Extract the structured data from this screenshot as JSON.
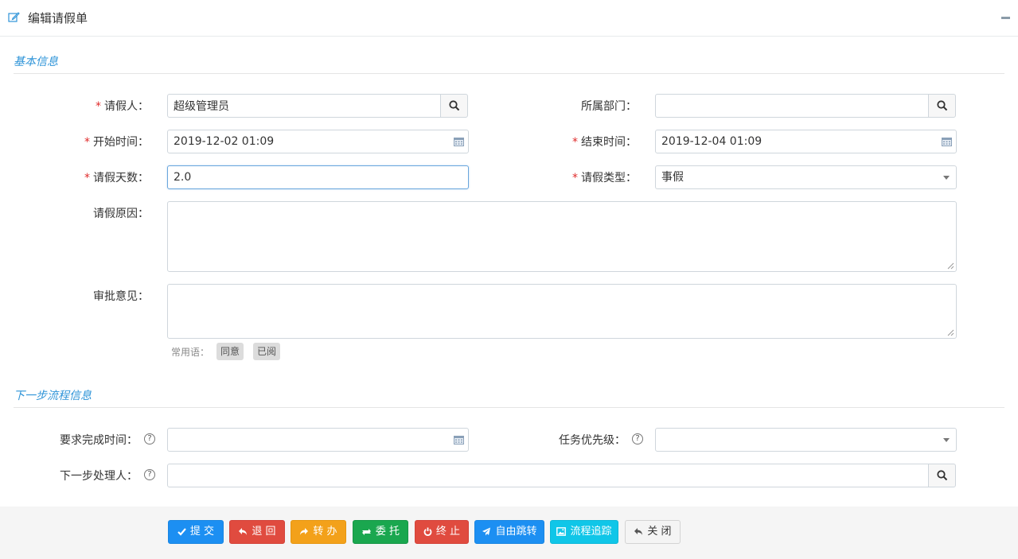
{
  "header": {
    "title": "编辑请假单"
  },
  "sections": {
    "basic": "基本信息",
    "next": "下一步流程信息"
  },
  "form": {
    "applicant": {
      "label": "请假人：",
      "required": "*",
      "value": "超级管理员"
    },
    "department": {
      "label": "所属部门：",
      "value": ""
    },
    "start_time": {
      "label": "开始时间：",
      "required": "*",
      "value": "2019-12-02 01:09"
    },
    "end_time": {
      "label": "结束时间：",
      "required": "*",
      "value": "2019-12-04 01:09"
    },
    "days": {
      "label": "请假天数：",
      "required": "*",
      "value": "2.0"
    },
    "leave_type": {
      "label": "请假类型：",
      "required": "*",
      "value": "事假"
    },
    "reason": {
      "label": "请假原因：",
      "value": ""
    },
    "opinion": {
      "label": "审批意见：",
      "value": ""
    },
    "common_phrases": {
      "label": "常用语：",
      "items": [
        "同意",
        "已阅"
      ]
    }
  },
  "next_step": {
    "deadline": {
      "label": "要求完成时间：",
      "value": ""
    },
    "priority": {
      "label": "任务优先级：",
      "value": ""
    },
    "handler": {
      "label": "下一步处理人：",
      "value": ""
    },
    "help": "?"
  },
  "buttons": {
    "submit": "提 交",
    "return": "退 回",
    "transfer": "转 办",
    "delegate": "委 托",
    "terminate": "终 止",
    "free_jump": "自由跳转",
    "trace": "流程追踪",
    "close": "关 闭"
  },
  "colors": {
    "accent": "#2f94d8",
    "required": "#e02b2b",
    "blue": "#1c8ff2",
    "red": "#e04b3f",
    "orange": "#f3a11a",
    "green": "#1aa74f",
    "cyan": "#10c6e8"
  }
}
